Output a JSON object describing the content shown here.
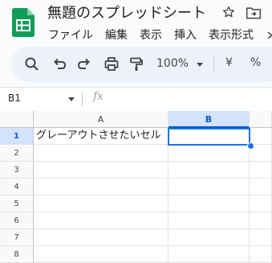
{
  "app": {
    "title": "無題のスプレッドシート",
    "menu": [
      "ファイル",
      "編集",
      "表示",
      "挿入",
      "表示形式"
    ]
  },
  "toolbar": {
    "zoom": "100%",
    "currency": "¥",
    "percent": "%"
  },
  "formula_bar": {
    "cell_ref": "B1",
    "fx": "fx",
    "content": ""
  },
  "grid": {
    "columns": [
      "A",
      "B"
    ],
    "rows": [
      "1",
      "2",
      "3",
      "4",
      "5",
      "6",
      "7",
      "8"
    ],
    "cells": {
      "A1": "グレーアウトさせたいセル",
      "B1": ""
    },
    "selected_cell": "B1"
  },
  "colors": {
    "accent": "#1a73e8",
    "selected_header_bg": "#d3e3fd",
    "sheets_green": "#0f9d58"
  }
}
